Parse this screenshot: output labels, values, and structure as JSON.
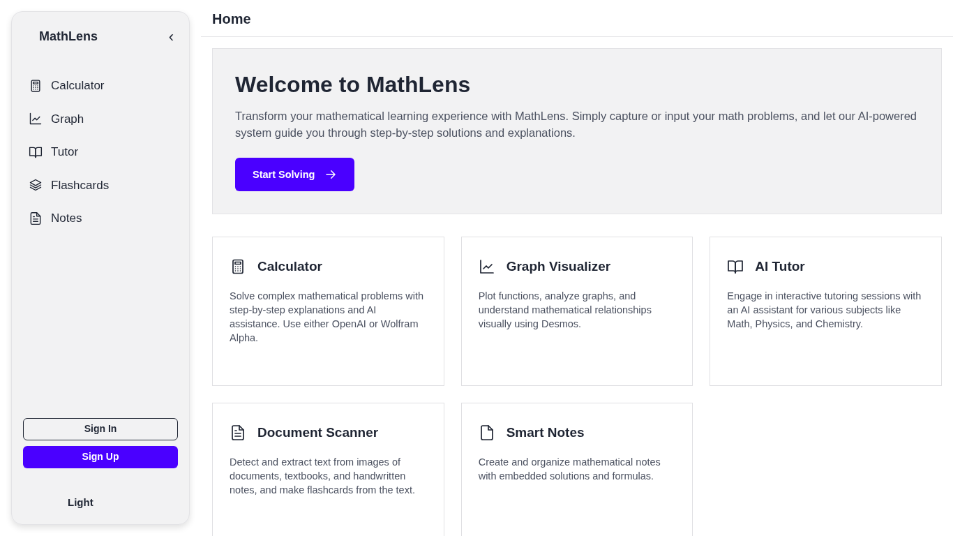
{
  "sidebar": {
    "brand": "MathLens",
    "collapse_icon": "‹",
    "items": [
      {
        "label": "Calculator",
        "kind": "calculator"
      },
      {
        "label": "Graph",
        "kind": "graph"
      },
      {
        "label": "Tutor",
        "kind": "book"
      },
      {
        "label": "Flashcards",
        "kind": "layers"
      },
      {
        "label": "Notes",
        "kind": "document"
      }
    ],
    "buttons": [
      {
        "label": "Sign In",
        "kind": "outline"
      },
      {
        "label": "Sign Up",
        "kind": "primary"
      }
    ],
    "theme_toggle": "Light"
  },
  "header": {
    "title": "Home"
  },
  "hero": {
    "title": "Welcome to MathLens",
    "text": "Transform your mathematical learning experience with MathLens. Simply capture or input your math problems, and let our AI-powered system guide you through step-by-step solutions and explanations.",
    "button": "Start Solving"
  },
  "cards": [
    {
      "title": "Calculator",
      "kind": "calculator",
      "text": "Solve complex mathematical problems with step-by-step explanations and AI assistance. Use either OpenAI or Wolfram Alpha."
    },
    {
      "title": "Graph Visualizer",
      "kind": "graph",
      "text": "Plot functions, analyze graphs, and understand mathematical relationships visually using Desmos."
    },
    {
      "title": "AI Tutor",
      "kind": "book",
      "text": "Engage in interactive tutoring sessions with an AI assistant for various subjects like Math, Physics, and Chemistry."
    },
    {
      "title": "Document Scanner",
      "kind": "document",
      "text": "Detect and extract text from images of documents, textbooks, and handwritten notes, and make flashcards from the text."
    },
    {
      "title": "Smart Notes",
      "kind": "file",
      "text": "Create and organize mathematical notes with embedded solutions and formulas."
    }
  ]
}
